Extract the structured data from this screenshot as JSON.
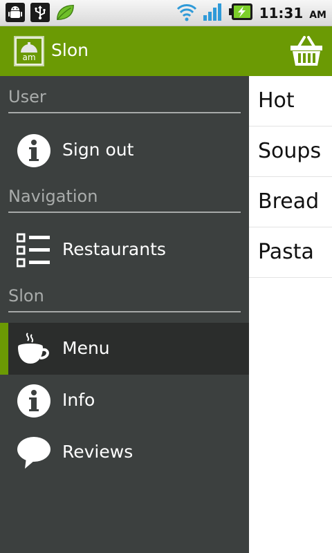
{
  "status_bar": {
    "time": "11:31",
    "ampm": "AM",
    "icons": [
      "android-debug-icon",
      "usb-icon",
      "leaf-icon",
      "wifi-icon",
      "signal-icon",
      "battery-charging-icon"
    ]
  },
  "action_bar": {
    "logo_text": "am",
    "title": "Slon",
    "cart_icon": "basket-icon"
  },
  "drawer": {
    "sections": [
      {
        "header": "User",
        "items": [
          {
            "label": "Sign out",
            "icon": "info-icon"
          }
        ]
      },
      {
        "header": "Navigation",
        "items": [
          {
            "label": "Restaurants",
            "icon": "list-icon"
          }
        ]
      },
      {
        "header": "Slon",
        "items": [
          {
            "label": "Menu",
            "icon": "coffee-cup-icon",
            "active": true
          },
          {
            "label": "Info",
            "icon": "info-icon"
          },
          {
            "label": "Reviews",
            "icon": "speech-bubble-icon"
          }
        ]
      }
    ]
  },
  "categories": [
    "Hot",
    "Soups",
    "Bread",
    "Pasta"
  ],
  "colors": {
    "accent": "#6b9a04",
    "drawer_bg": "#3c403f",
    "active_bg": "#2b2d2c"
  }
}
